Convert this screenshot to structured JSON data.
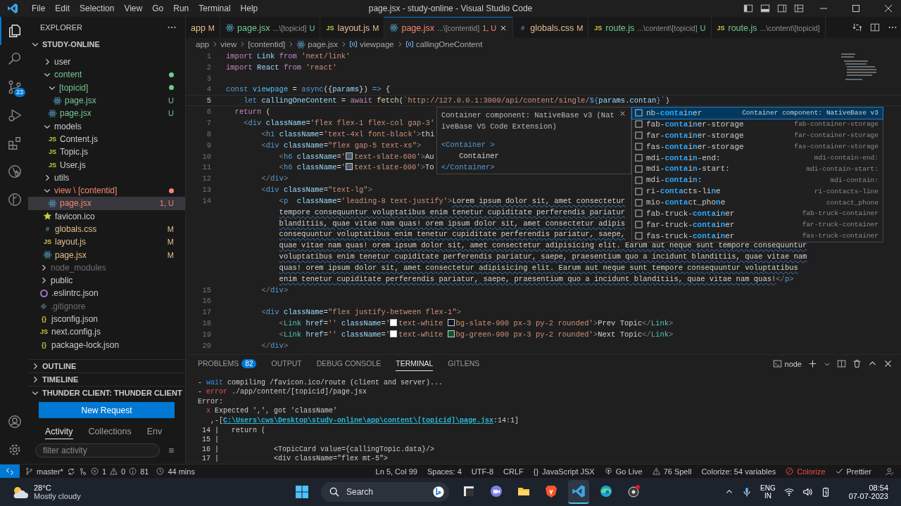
{
  "window": {
    "title": "page.jsx - study-online - Visual Studio Code"
  },
  "menu": [
    "File",
    "Edit",
    "Selection",
    "View",
    "Go",
    "Run",
    "Terminal",
    "Help"
  ],
  "activity_bar": [
    {
      "selected": true
    },
    {
      "selected": false
    },
    {
      "selected": false,
      "badge": "23"
    },
    {
      "selected": false
    },
    {
      "selected": false
    },
    {
      "selected": false
    },
    {
      "selected": false
    }
  ],
  "sidebar": {
    "title": "EXPLORER",
    "project": "STUDY-ONLINE",
    "tree": [
      {
        "kind": "folder",
        "label": "user",
        "expanded": false
      },
      {
        "kind": "folder",
        "label": "content",
        "expanded": true,
        "color": "#73c991",
        "dot": true,
        "children": [
          {
            "kind": "folder",
            "label": "[topicid]",
            "expanded": true,
            "color": "#73c991",
            "dot": true,
            "children": [
              {
                "kind": "react",
                "label": "page.jsx",
                "color": "#73c991",
                "status": "U",
                "selected": false
              }
            ]
          },
          {
            "kind": "react",
            "label": "page.jsx",
            "color": "#73c991",
            "status": "U",
            "selected": false
          }
        ]
      },
      {
        "kind": "folder",
        "label": "models",
        "expanded": true,
        "children": [
          {
            "kind": "js",
            "icon_text": "JS",
            "label": "Content.js",
            "selected": false
          },
          {
            "kind": "js",
            "icon_text": "JS",
            "label": "Topic.js",
            "selected": false
          },
          {
            "kind": "js",
            "icon_text": "JS",
            "label": "User.js",
            "selected": false
          }
        ]
      },
      {
        "kind": "folder",
        "label": "utils",
        "expanded": false
      },
      {
        "kind": "folder",
        "label": "view \\ [contentid]",
        "expanded": true,
        "color": "#f48771",
        "dot": true,
        "children": [
          {
            "kind": "react",
            "label": "page.jsx",
            "color": "#f48771",
            "status": "1, U",
            "selected": true
          }
        ]
      },
      {
        "kind": "star",
        "label": "favicon.ico",
        "selected": false
      },
      {
        "kind": "css",
        "icon_text": "#",
        "label": "globals.css",
        "color": "#e2c08d",
        "status": "M",
        "selected": false
      },
      {
        "kind": "js",
        "icon_text": "JS",
        "label": "layout.js",
        "color": "#e2c08d",
        "status": "M",
        "selected": false
      },
      {
        "kind": "react",
        "label": "page.jsx",
        "color": "#e2c08d",
        "status": "M",
        "selected": false
      }
    ],
    "root_items": [
      {
        "kind": "folder",
        "label": "node_modules",
        "expanded": false,
        "color": "#6f6f6f"
      },
      {
        "kind": "folder",
        "label": "public",
        "expanded": false
      },
      {
        "kind": "eslint",
        "label": ".eslintrc.json",
        "selected": false
      },
      {
        "kind": "git",
        "label": ".gitignore",
        "color": "#6f6f6f",
        "selected": false
      },
      {
        "kind": "json",
        "icon_text": "{}",
        "label": "jsconfig.json",
        "selected": false
      },
      {
        "kind": "js",
        "icon_text": "JS",
        "label": "next.config.js",
        "selected": false
      },
      {
        "kind": "json",
        "icon_text": "{}",
        "label": "package-lock.json",
        "selected": false
      }
    ],
    "sections": [
      {
        "title": "OUTLINE",
        "expanded": false
      },
      {
        "title": "TIMELINE",
        "expanded": false
      },
      {
        "title": "THUNDER CLIENT: THUNDER CLIENT",
        "expanded": true
      }
    ],
    "thunder": {
      "button": "New Request",
      "tabs": [
        {
          "label": "Activity",
          "selected": true
        },
        {
          "label": "Collections",
          "selected": false
        },
        {
          "label": "Env",
          "selected": false
        }
      ],
      "filter": {
        "placeholder": "filter activity"
      }
    }
  },
  "tabs": [
    {
      "label": "app",
      "status": "M",
      "color": "#e2c08d",
      "selected": false
    },
    {
      "kind": "react",
      "label": "page.jsx",
      "path": "...\\[topicid]",
      "status": "U",
      "color": "#73c991",
      "selected": false
    },
    {
      "kind": "js",
      "icon_text": "JS",
      "label": "layout.js",
      "status": "M",
      "color": "#e2c08d",
      "selected": false
    },
    {
      "kind": "react",
      "label": "page.jsx",
      "path": "...\\[contentid]",
      "status": "1, U",
      "color": "#f48771",
      "selected": true
    },
    {
      "kind": "css",
      "icon_text": "#",
      "label": "globals.css",
      "status": "M",
      "color": "#e2c08d",
      "selected": false
    },
    {
      "kind": "js",
      "icon_text": "JS",
      "label": "route.js",
      "path": "...\\content\\[topicid]",
      "status": "U",
      "color": "#73c991",
      "selected": false
    },
    {
      "kind": "js",
      "icon_text": "JS",
      "label": "route.js",
      "path": "...\\content\\[topicid]",
      "color": "#73c991",
      "selected": false
    }
  ],
  "breadcrumbs": [
    {
      "label": "app"
    },
    {
      "label": "view"
    },
    {
      "label": "[contentid]"
    },
    {
      "kind": "react",
      "label": "page.jsx"
    },
    {
      "kind": "symbol",
      "label": "viewpage"
    },
    {
      "kind": "symbol",
      "label": "callingOneContent"
    }
  ],
  "code": [
    {
      "number": "1",
      "tokens": [
        {
          "kind": "ctrl",
          "text": "import"
        },
        {
          "kind": "var",
          "text": " Link "
        },
        {
          "kind": "ctrl",
          "text": "from"
        },
        {
          "kind": "str",
          "text": " 'next/link'"
        }
      ]
    },
    {
      "number": "2",
      "tokens": [
        {
          "kind": "ctrl",
          "text": "import"
        },
        {
          "kind": "var",
          "text": " React "
        },
        {
          "kind": "ctrl",
          "text": "from"
        },
        {
          "kind": "str",
          "text": " 'react'"
        }
      ]
    },
    {
      "number": "3"
    },
    {
      "number": "4",
      "tokens": [
        {
          "kind": "decl",
          "text": "const"
        },
        {
          "kind": "cst",
          "text": " viewpage"
        },
        {
          "kind": "punct",
          "text": " = "
        },
        {
          "kind": "decl",
          "text": "async"
        },
        {
          "kind": "punct",
          "text": "({"
        },
        {
          "kind": "var",
          "text": "params"
        },
        {
          "kind": "punct",
          "text": "}) "
        },
        {
          "kind": "decl",
          "text": "=>"
        },
        {
          "kind": "punct",
          "text": " {"
        }
      ]
    },
    {
      "number": "5",
      "current": true,
      "tokens": [
        {
          "kind": "decl",
          "text": "    let"
        },
        {
          "kind": "var",
          "text": " callingOneContent"
        },
        {
          "kind": "punct",
          "text": " = "
        },
        {
          "kind": "ctrl",
          "text": "await"
        },
        {
          "kind": "fn",
          "text": " fetch"
        },
        {
          "kind": "punct",
          "text": "("
        },
        {
          "kind": "str",
          "text": "`http://127.0.0.1:3000/api/content/single/"
        },
        {
          "kind": "decl",
          "text": "${"
        },
        {
          "kind": "var",
          "text": "params"
        },
        {
          "kind": "punct",
          "text": "."
        },
        {
          "kind": "var",
          "text": "contan"
        },
        {
          "kind": "decl",
          "text": "}"
        },
        {
          "kind": "str",
          "text": "`"
        },
        {
          "kind": "punct",
          "text": ")"
        }
      ]
    },
    {
      "number": "6",
      "tokens": [
        {
          "kind": "ctrl",
          "text": "  return"
        },
        {
          "kind": "punct",
          "text": " ("
        }
      ]
    },
    {
      "number": "7",
      "tokens": [
        {
          "kind": "br",
          "text": "    <"
        },
        {
          "kind": "tag",
          "text": "div"
        },
        {
          "kind": "attr",
          "text": " className"
        },
        {
          "kind": "punct",
          "text": "="
        },
        {
          "kind": "str",
          "text": "'flex flex-1 flex-col gap-3'"
        }
      ]
    },
    {
      "number": "8",
      "tokens": [
        {
          "kind": "br",
          "text": "        <"
        },
        {
          "kind": "tag",
          "text": "h1"
        },
        {
          "kind": "attr",
          "text": " className"
        },
        {
          "kind": "punct",
          "text": "="
        },
        {
          "kind": "str",
          "text": "'text-4xl font-black'"
        },
        {
          "kind": "br",
          "text": ">"
        },
        {
          "kind": "text",
          "text": "thi"
        }
      ]
    },
    {
      "number": "9",
      "tokens": [
        {
          "kind": "br",
          "text": "        <"
        },
        {
          "kind": "tag",
          "text": "div"
        },
        {
          "kind": "attr",
          "text": " className"
        },
        {
          "kind": "punct",
          "text": "="
        },
        {
          "kind": "str",
          "text": "\"flex gap-5 text-xs\""
        },
        {
          "kind": "br",
          "text": ">"
        }
      ]
    },
    {
      "number": "10",
      "tokens": [
        {
          "kind": "br",
          "text": "            <"
        },
        {
          "kind": "tag",
          "text": "h6"
        },
        {
          "kind": "attr",
          "text": " className"
        },
        {
          "kind": "punct",
          "text": "="
        },
        {
          "kind": "str",
          "text": "'"
        },
        {
          "kind": "swatch",
          "color": "#475569"
        },
        {
          "kind": "str",
          "text": "text-slate-600'"
        },
        {
          "kind": "br",
          "text": ">"
        },
        {
          "kind": "text",
          "text": "Au"
        }
      ]
    },
    {
      "number": "11",
      "tokens": [
        {
          "kind": "br",
          "text": "            <"
        },
        {
          "kind": "tag",
          "text": "h6"
        },
        {
          "kind": "attr",
          "text": " className"
        },
        {
          "kind": "punct",
          "text": "="
        },
        {
          "kind": "str",
          "text": "'"
        },
        {
          "kind": "swatch",
          "color": "#475569"
        },
        {
          "kind": "str",
          "text": "text-slate-600'"
        },
        {
          "kind": "br",
          "text": ">"
        },
        {
          "kind": "text",
          "text": "To"
        }
      ]
    },
    {
      "number": "12",
      "tokens": [
        {
          "kind": "br",
          "text": "        </"
        },
        {
          "kind": "tag",
          "text": "div"
        },
        {
          "kind": "br",
          "text": ">"
        }
      ]
    },
    {
      "number": "13",
      "tokens": [
        {
          "kind": "br",
          "text": "        <"
        },
        {
          "kind": "tag",
          "text": "div"
        },
        {
          "kind": "attr",
          "text": " className"
        },
        {
          "kind": "punct",
          "text": "="
        },
        {
          "kind": "str",
          "text": "\"text-lg\""
        },
        {
          "kind": "br",
          "text": ">"
        }
      ]
    },
    {
      "number": "14",
      "tokens": [
        {
          "kind": "br",
          "text": "            <"
        },
        {
          "kind": "tag",
          "text": "p"
        },
        {
          "kind": "attr",
          "text": "  className"
        },
        {
          "kind": "punct",
          "text": "="
        },
        {
          "kind": "str",
          "text": "'leading-8 text-justify'"
        },
        {
          "kind": "br",
          "text": ">"
        },
        {
          "kind": "prose",
          "text": "Lorem ipsum dolor sit, amet consectetur"
        }
      ]
    },
    {
      "tokens": [
        {
          "kind": "prose",
          "text": "tempore consequuntur voluptatibus enim tenetur cupiditate perferendis pariatur"
        }
      ]
    },
    {
      "tokens": [
        {
          "kind": "prose",
          "text": "blanditiis, quae vitae nam quas! orem ipsum dolor sit, amet consectetur adipis"
        }
      ]
    },
    {
      "tokens": [
        {
          "kind": "prose",
          "text": "consequuntur voluptatibus enim tenetur cupiditate perferendis pariatur, saepe,"
        }
      ]
    },
    {
      "tokens": [
        {
          "kind": "prose",
          "text": "quae vitae nam quas! orem ipsum dolor sit, amet consectetur adipisicing elit. Earum aut neque sunt tempore consequuntur"
        }
      ]
    },
    {
      "tokens": [
        {
          "kind": "prose",
          "text": "voluptatibus enim tenetur cupiditate perferendis pariatur, saepe, praesentium quo a incidunt blanditiis, quae vitae nam"
        }
      ]
    },
    {
      "tokens": [
        {
          "kind": "prose",
          "text": "quas! orem ipsum dolor sit, amet consectetur adipisicing elit. Earum aut neque sunt tempore consequuntur voluptatibus"
        }
      ]
    },
    {
      "tokens": [
        {
          "kind": "prose",
          "text": "enim tenetur cupiditate perferendis pariatur, saepe, praesentium quo a incidunt blanditiis, quae vitae nam quas!"
        },
        {
          "kind": "br",
          "text": "</"
        },
        {
          "kind": "tag",
          "text": "p"
        },
        {
          "kind": "br",
          "text": ">"
        }
      ]
    },
    {
      "number": "15",
      "tokens": [
        {
          "kind": "br",
          "text": "        </"
        },
        {
          "kind": "tag",
          "text": "div"
        },
        {
          "kind": "br",
          "text": ">"
        }
      ]
    },
    {
      "number": "16"
    },
    {
      "number": "17",
      "tokens": [
        {
          "kind": "br",
          "text": "        <"
        },
        {
          "kind": "tag",
          "text": "div"
        },
        {
          "kind": "attr",
          "text": " className"
        },
        {
          "kind": "punct",
          "text": "="
        },
        {
          "kind": "str",
          "text": "\"flex justify-between flex-1\""
        },
        {
          "kind": "br",
          "text": ">"
        }
      ]
    },
    {
      "number": "18",
      "tokens": [
        {
          "kind": "br",
          "text": "            <"
        },
        {
          "kind": "comp",
          "text": "Link"
        },
        {
          "kind": "attr",
          "text": " href"
        },
        {
          "kind": "punct",
          "text": "="
        },
        {
          "kind": "str",
          "text": "''"
        },
        {
          "kind": "attr",
          "text": " className"
        },
        {
          "kind": "punct",
          "text": "="
        },
        {
          "kind": "str",
          "text": "'"
        },
        {
          "kind": "swatch",
          "color": "#ffffff"
        },
        {
          "kind": "str",
          "text": "text-white "
        },
        {
          "kind": "swatch",
          "color": "#0f172a"
        },
        {
          "kind": "str",
          "text": "bg-slate-900 px-3 py-2 rounded'"
        },
        {
          "kind": "br",
          "text": ">"
        },
        {
          "kind": "text",
          "text": "Prev Topic"
        },
        {
          "kind": "br",
          "text": "</"
        },
        {
          "kind": "comp",
          "text": "Link"
        },
        {
          "kind": "br",
          "text": ">"
        }
      ]
    },
    {
      "number": "19",
      "tokens": [
        {
          "kind": "br",
          "text": "            <"
        },
        {
          "kind": "comp",
          "text": "Link"
        },
        {
          "kind": "attr",
          "text": " href"
        },
        {
          "kind": "punct",
          "text": "="
        },
        {
          "kind": "str",
          "text": "''"
        },
        {
          "kind": "attr",
          "text": " className"
        },
        {
          "kind": "punct",
          "text": "="
        },
        {
          "kind": "str",
          "text": "'"
        },
        {
          "kind": "swatch",
          "color": "#ffffff"
        },
        {
          "kind": "str",
          "text": "text-white "
        },
        {
          "kind": "swatch",
          "color": "#14532d"
        },
        {
          "kind": "str",
          "text": "bg-green-900 px-3 py-2 rounded'"
        },
        {
          "kind": "br",
          "text": ">"
        },
        {
          "kind": "text",
          "text": "Next Topic"
        },
        {
          "kind": "br",
          "text": "</"
        },
        {
          "kind": "comp",
          "text": "Link"
        },
        {
          "kind": "br",
          "text": ">"
        }
      ]
    },
    {
      "number": "20",
      "tokens": [
        {
          "kind": "br",
          "text": "        </"
        },
        {
          "kind": "tag",
          "text": "div"
        },
        {
          "kind": "br",
          "text": ">"
        }
      ]
    }
  ],
  "hover": {
    "lines": [
      "Container component: NativeBase v3 (Nat",
      "iveBase VS Code Extension)"
    ],
    "code": [
      "<Container >",
      "    Container",
      "</Container>"
    ]
  },
  "suggestions": [
    {
      "label": "nb-**conta**i**n**er",
      "detail": "Container component: NativeBase v3",
      "selected": true
    },
    {
      "label": "fab-**conta**i**n**er-storage",
      "detail": "fab-container-storage",
      "selected": false
    },
    {
      "label": "far-**conta**i**n**er-storage",
      "detail": "far-container-storage",
      "selected": false
    },
    {
      "label": "fas-**conta**i**n**er-storage",
      "detail": "fas-container-storage",
      "selected": false
    },
    {
      "label": "mdi-**conta**i**n**-end:",
      "detail": "mdi-contain-end:",
      "selected": false
    },
    {
      "label": "mdi-**conta**i**n**-start:",
      "detail": "mdi-contain-start:",
      "selected": false
    },
    {
      "label": "mdi-**conta**i**n**:",
      "detail": "mdi-contain:",
      "selected": false
    },
    {
      "label": "ri-**conta**cts-li**n**e",
      "detail": "ri-contacts-line",
      "selected": false
    },
    {
      "label": "mio-**conta**ct_pho**n**e",
      "detail": "contact_phone",
      "selected": false
    },
    {
      "label": "fab-truck-**conta**i**n**er",
      "detail": "fab-truck-container",
      "selected": false
    },
    {
      "label": "far-truck-**conta**i**n**er",
      "detail": "far-truck-container",
      "selected": false
    },
    {
      "label": "fas-truck-**conta**i**n**er",
      "detail": "fas-truck-container",
      "selected": false
    }
  ],
  "panel": {
    "tabs": [
      {
        "label": "PROBLEMS",
        "badge": "82",
        "selected": false
      },
      {
        "label": "OUTPUT",
        "selected": false
      },
      {
        "label": "DEBUG CONSOLE",
        "selected": false
      },
      {
        "label": "TERMINAL",
        "selected": true
      },
      {
        "label": "GITLENS",
        "selected": false
      }
    ],
    "terminal_name": "node",
    "terminal": [
      [
        {
          "kind": "plain",
          "text": "- "
        },
        {
          "kind": "info",
          "text": "wait"
        },
        {
          "kind": "plain",
          "text": " compiling /favicon.ico/route (client and server)..."
        }
      ],
      [
        {
          "kind": "plain",
          "text": "- "
        },
        {
          "kind": "err",
          "text": "error"
        },
        {
          "kind": "plain",
          "text": " ./app/content/[topicid]/page.jsx"
        }
      ],
      [
        {
          "kind": "plain",
          "text": "Error:"
        }
      ],
      [
        {
          "kind": "err",
          "text": "  x"
        },
        {
          "kind": "plain",
          "text": " Expected ',', got 'className'"
        }
      ],
      [
        {
          "kind": "plain",
          "text": "   ,-["
        },
        {
          "kind": "link",
          "text": "C:\\Users\\cws\\Desktop\\study-online\\app\\content\\[topicid]\\page.jsx"
        },
        {
          "kind": "plain",
          "text": ":14:1]"
        }
      ],
      [
        {
          "kind": "plain",
          "text": " 14 |   return ("
        }
      ],
      [
        {
          "kind": "plain",
          "text": " 15 |"
        }
      ],
      [
        {
          "kind": "plain",
          "text": " 16 |             <TopicCard value={callingTopic.data}/>"
        }
      ],
      [
        {
          "kind": "plain",
          "text": " 17 |             <div className=\"flex mt-5\">"
        }
      ]
    ]
  },
  "status_bar": {
    "branch": "master*",
    "errors": "1",
    "warnings": "0",
    "infos": "81",
    "time": "44 mins",
    "items": [
      {
        "kind": "text",
        "text": "Ln 5, Col 99"
      },
      {
        "kind": "text",
        "text": "Spaces: 4"
      },
      {
        "kind": "text",
        "text": "UTF-8"
      },
      {
        "kind": "text",
        "text": "CRLF"
      },
      {
        "kind": "braces",
        "icon_text": "{}",
        "text": "JavaScript JSX"
      },
      {
        "kind": "live",
        "text": "Go Live"
      },
      {
        "kind": "warn",
        "text": "76 Spell"
      },
      {
        "kind": "text",
        "text": "Colorize: 54 variables"
      },
      {
        "kind": "blocked",
        "text": "Colorize"
      },
      {
        "kind": "check",
        "text": "Prettier"
      }
    ]
  },
  "taskbar": {
    "weather": {
      "temp": "28°C",
      "desc": "Mostly cloudy"
    },
    "search": {
      "placeholder": "Search"
    },
    "apps": [
      {
        "active": false
      },
      {
        "active": false
      },
      {
        "active": false
      },
      {
        "active": false
      },
      {
        "active": true
      },
      {
        "active": false
      },
      {
        "active": false
      }
    ],
    "language": [
      "ENG",
      "IN"
    ],
    "time": "08:54",
    "date": "07-07-2023"
  }
}
